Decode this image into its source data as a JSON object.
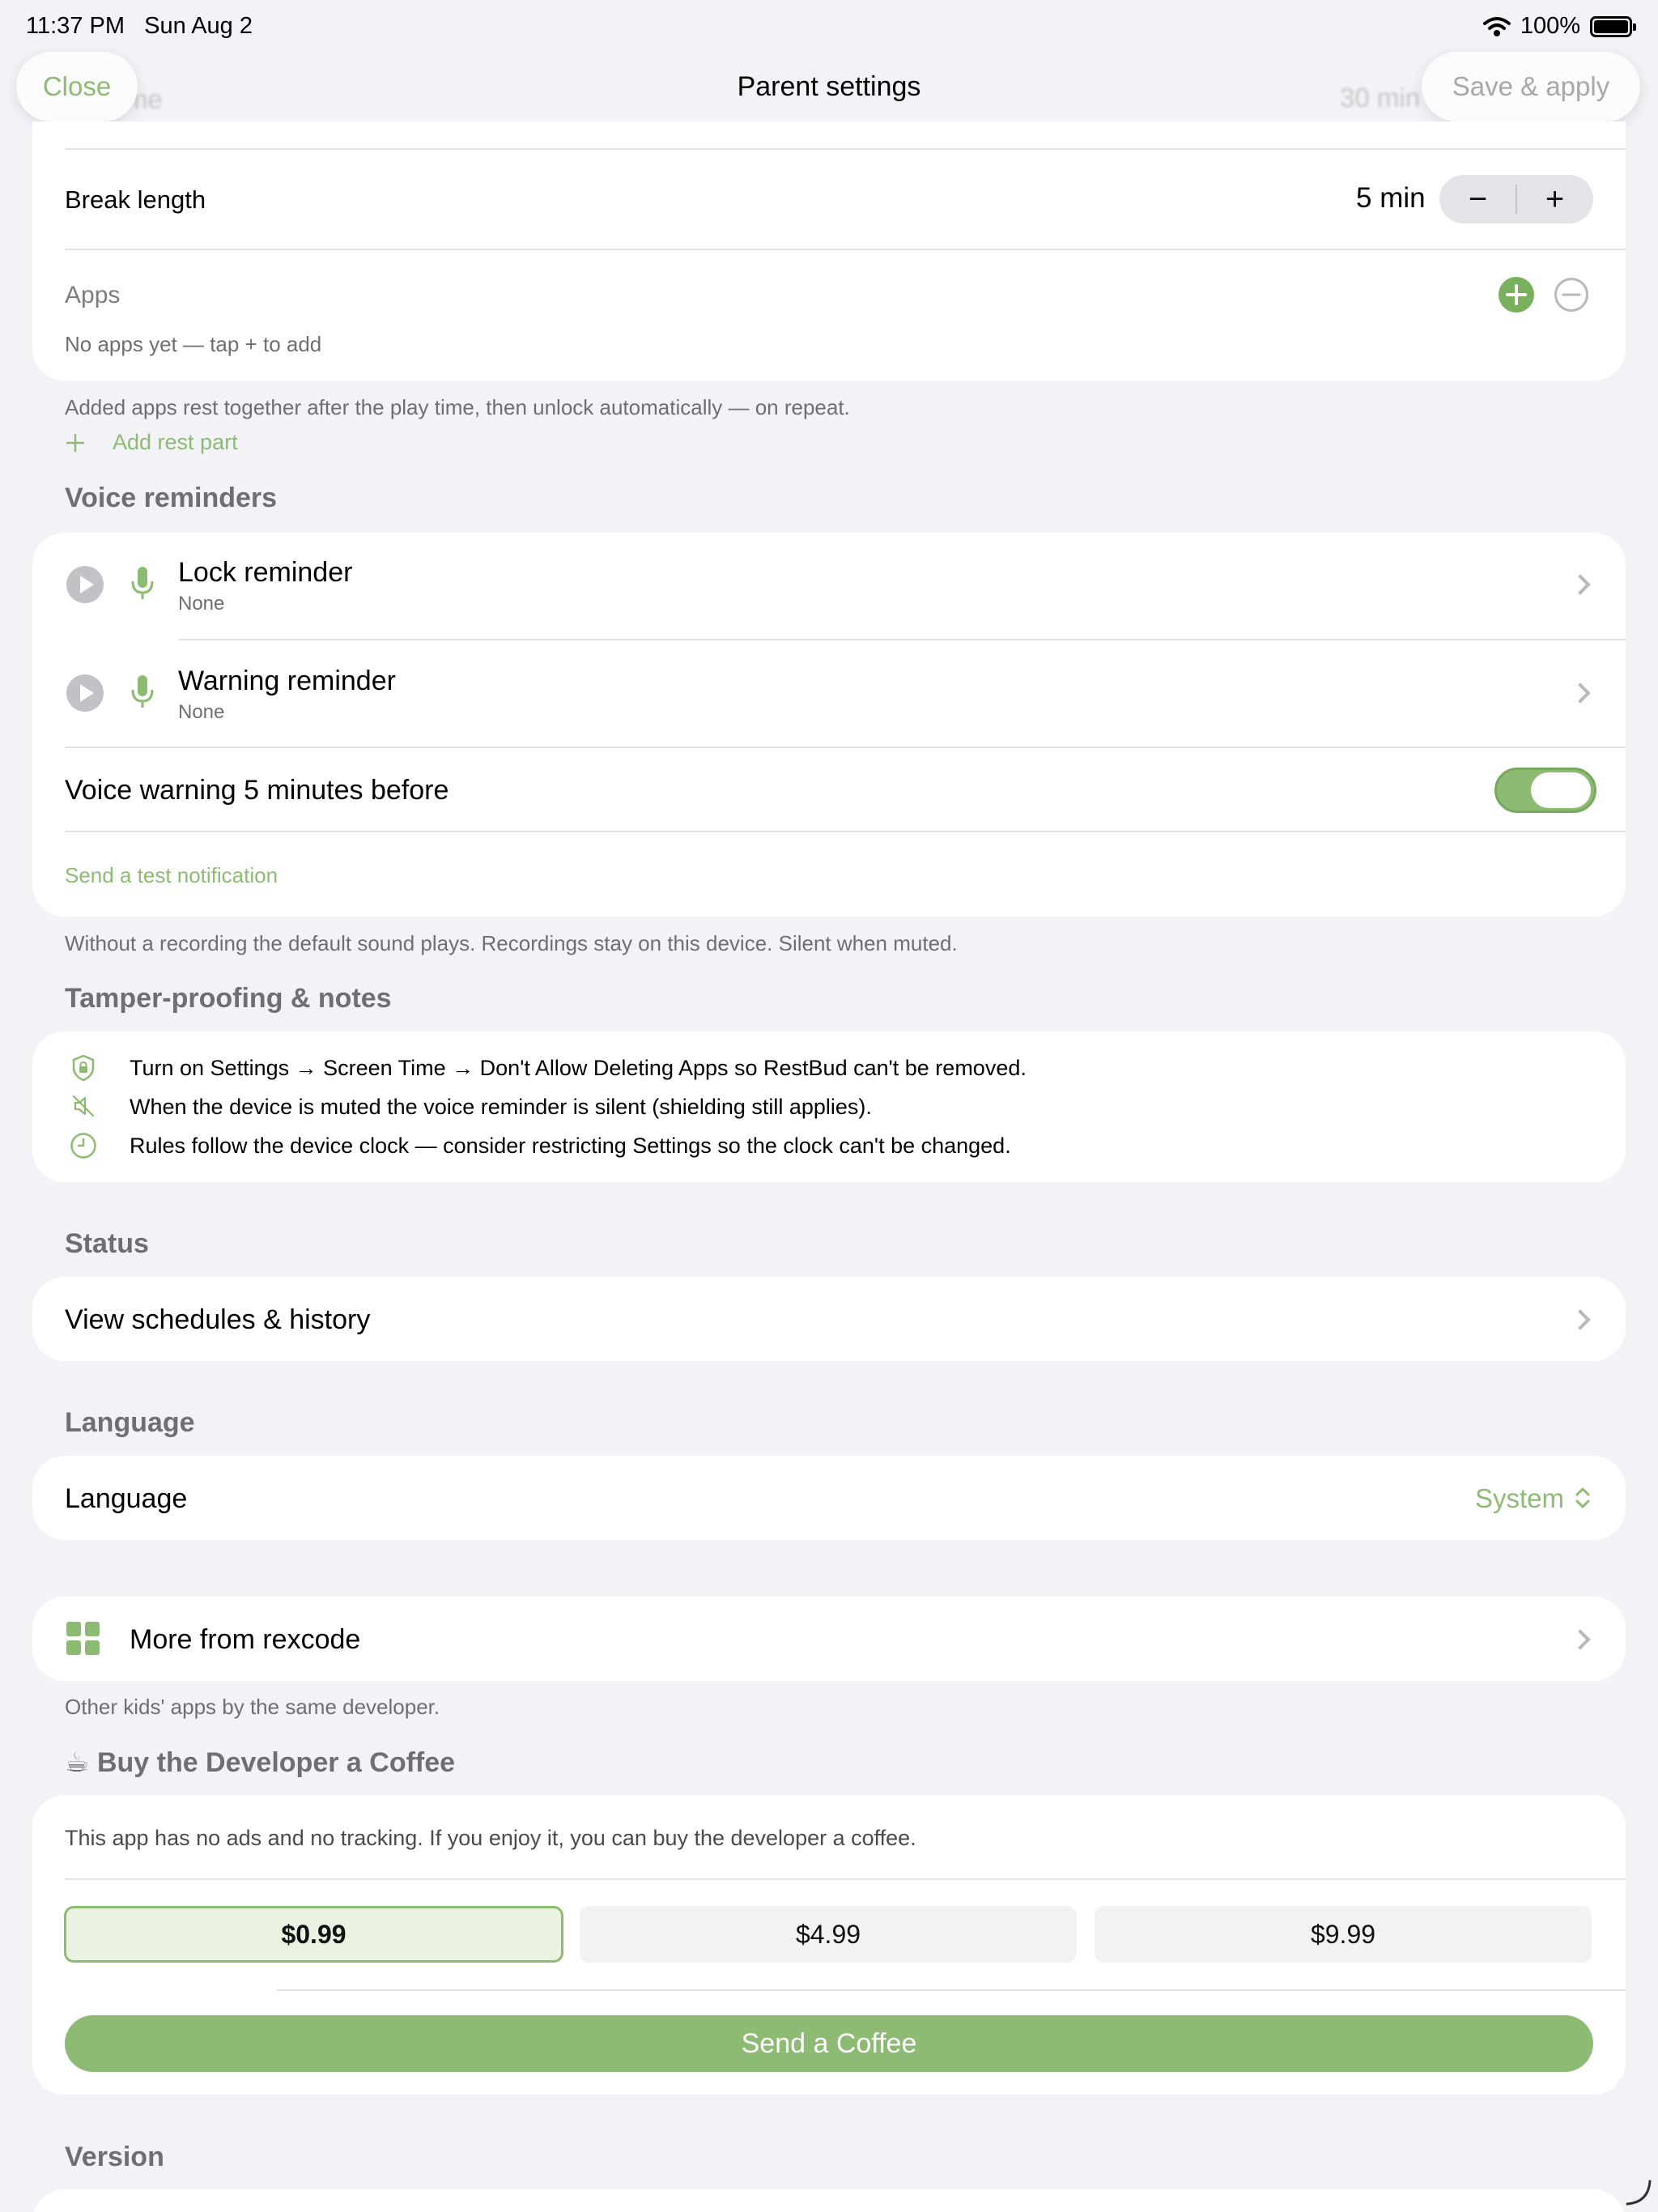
{
  "status_bar": {
    "time": "11:37 PM",
    "date": "Sun Aug 2",
    "battery": "100%"
  },
  "nav": {
    "close_label": "Close",
    "title": "Parent settings",
    "save_label": "Save & apply",
    "ghost_left": "me",
    "ghost_right": "30 min"
  },
  "rest_card": {
    "break_label": "Break length",
    "break_value": "5 min",
    "minus": "−",
    "plus": "+",
    "apps_label": "Apps",
    "apps_empty": "No apps yet — tap + to add"
  },
  "rest_footnote": "Added apps rest together after the play time, then unlock automatically — on repeat.",
  "add_rest_part": "Add rest part",
  "voice": {
    "section_title": "Voice reminders",
    "lock_title": "Lock reminder",
    "lock_value": "None",
    "warning_title": "Warning reminder",
    "warning_value": "None",
    "toggle_label": "Voice warning 5 minutes before",
    "toggle_on": true,
    "test_link": "Send a test notification",
    "footnote": "Without a recording the default sound plays. Recordings stay on this device. Silent when muted."
  },
  "tamper": {
    "section_title": "Tamper-proofing & notes",
    "items": [
      {
        "icon": "shield-lock-icon",
        "text": "Turn on Settings → Screen Time → Don't Allow Deleting Apps so RestBud can't be removed."
      },
      {
        "icon": "speaker-muted-icon",
        "text": "When the device is muted the voice reminder is silent (shielding still applies)."
      },
      {
        "icon": "clock-icon",
        "text": "Rules follow the device clock — consider restricting Settings so the clock can't be changed."
      }
    ]
  },
  "status": {
    "section_title": "Status",
    "row": "View schedules & history"
  },
  "language": {
    "section_title": "Language",
    "label": "Language",
    "value": "System"
  },
  "more": {
    "row": "More from rexcode",
    "footnote": "Other kids' apps by the same developer."
  },
  "coffee": {
    "section_title": "Buy the Developer a Coffee",
    "emoji": "☕",
    "description": "This app has no ads and no tracking. If you enjoy it, you can buy the developer a coffee.",
    "prices": [
      "$0.99",
      "$4.99",
      "$9.99"
    ],
    "selected_index": 0,
    "button": "Send a Coffee"
  },
  "version": {
    "section_title": "Version"
  },
  "colors": {
    "accent": "#8dbb73",
    "background": "#f2f2f7",
    "card": "#ffffff",
    "secondary_text": "#6e6e73"
  }
}
